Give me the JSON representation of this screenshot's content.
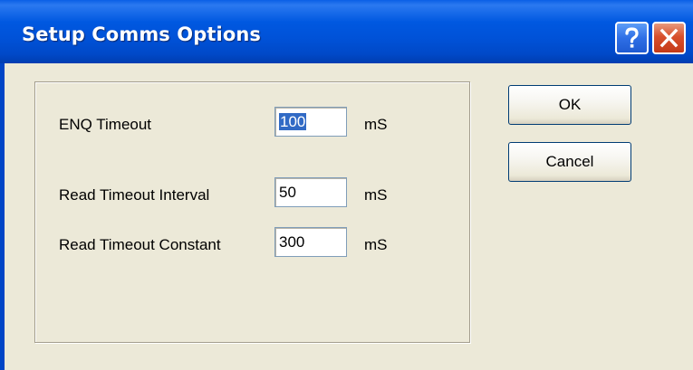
{
  "window": {
    "title": "Setup Comms Options",
    "help_glyph": "?",
    "close_glyph": "✕"
  },
  "settings": [
    {
      "label": "ENQ Timeout",
      "value": "100",
      "unit": "mS",
      "selected": true
    },
    {
      "label": "Read Timeout Interval",
      "value": "50",
      "unit": "mS",
      "selected": false
    },
    {
      "label": "Read Timeout Constant",
      "value": "300",
      "unit": "mS",
      "selected": false
    }
  ],
  "buttons": {
    "ok": "OK",
    "cancel": "Cancel"
  },
  "colors": {
    "titlebar": "#0054e3",
    "dialog_bg": "#ece9d8",
    "selection": "#316ac5",
    "close_button": "#d8502c"
  },
  "icons": {
    "help": "help-icon",
    "close": "close-icon"
  }
}
